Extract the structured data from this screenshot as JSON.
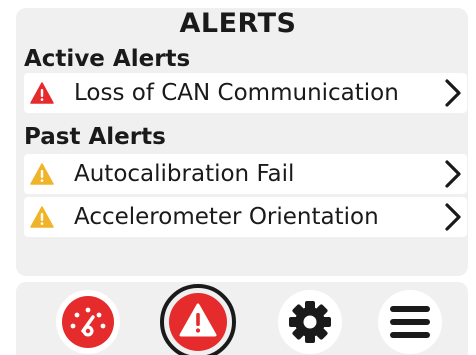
{
  "header": {
    "title": "ALERTS"
  },
  "active_alerts": {
    "heading": "Active Alerts",
    "items": [
      {
        "label": "Loss of CAN Communication",
        "severity": "critical",
        "color": "#e52b2b"
      }
    ]
  },
  "past_alerts": {
    "heading": "Past Alerts",
    "items": [
      {
        "label": "Autocalibration Fail",
        "severity": "warning",
        "color": "#f0b429"
      },
      {
        "label": "Accelerometer Orientation",
        "severity": "warning",
        "color": "#f0b429"
      }
    ]
  },
  "nav": {
    "items": [
      {
        "icon": "dashboard-gauge-icon",
        "active": false
      },
      {
        "icon": "alert-triangle-icon",
        "active": true
      },
      {
        "icon": "gear-icon",
        "active": false
      },
      {
        "icon": "menu-icon",
        "active": false
      }
    ]
  },
  "colors": {
    "critical": "#e52b2b",
    "warning": "#f0b429",
    "text": "#1a1a1a",
    "panel": "#f0f0f0"
  }
}
